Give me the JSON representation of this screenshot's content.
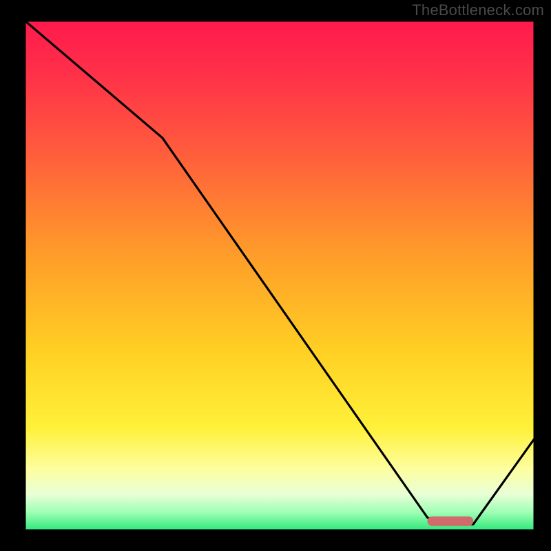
{
  "watermark": "TheBottleneck.com",
  "colors": {
    "bg": "#000000",
    "frame": "#000000",
    "curve": "#000000",
    "marker": "#d16a6a",
    "gradient_stops": [
      {
        "offset": 0.0,
        "color": "#ff1a4d"
      },
      {
        "offset": 0.1,
        "color": "#ff2f49"
      },
      {
        "offset": 0.25,
        "color": "#ff5a3d"
      },
      {
        "offset": 0.45,
        "color": "#ff9a2a"
      },
      {
        "offset": 0.65,
        "color": "#ffd023"
      },
      {
        "offset": 0.8,
        "color": "#fff13a"
      },
      {
        "offset": 0.88,
        "color": "#fdfea0"
      },
      {
        "offset": 0.93,
        "color": "#e8ffd7"
      },
      {
        "offset": 0.965,
        "color": "#9dffb4"
      },
      {
        "offset": 1.0,
        "color": "#2fe87a"
      }
    ]
  },
  "chart_data": {
    "type": "line",
    "title": "",
    "xlabel": "",
    "ylabel": "",
    "xlim": [
      0,
      100
    ],
    "ylim": [
      0,
      100
    ],
    "x": [
      0,
      27,
      79,
      82,
      88,
      100
    ],
    "values": [
      100,
      77,
      2.5,
      1.2,
      1.2,
      18
    ],
    "optimal_range_x": [
      79,
      88
    ],
    "notes": "Values are bottleneck-percent; 0 is at bottom (green), 100 at top (red). Curve starts top-left, breaks slope near x≈27, descends to a flat minimum around x≈79–88, then rises to ≈18% at x=100. Marker shows the optimal (minimum-bottleneck) zone."
  }
}
